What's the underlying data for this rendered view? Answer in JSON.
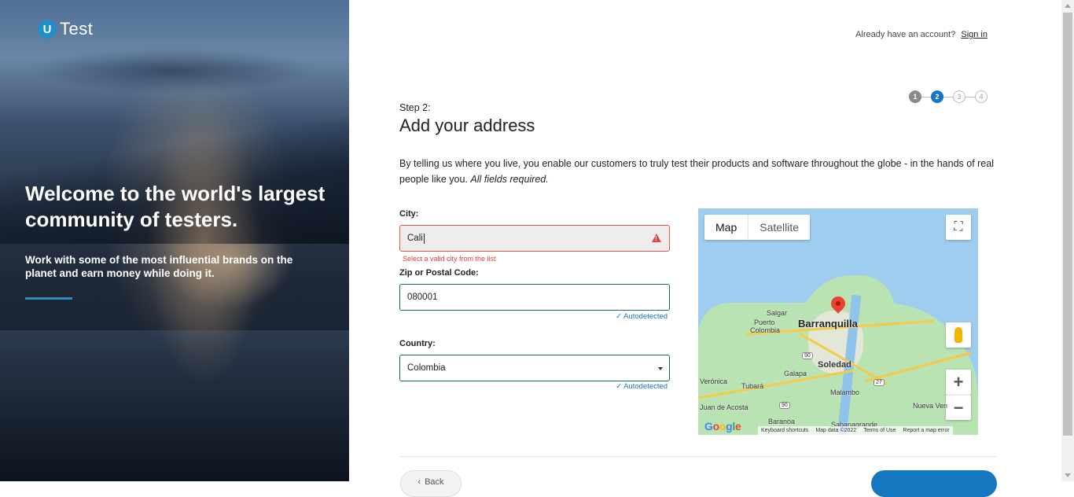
{
  "brand": {
    "badge": "U",
    "name": "Test",
    "accent": "#1477c0"
  },
  "hero": {
    "title": "Welcome to the world's largest community of testers.",
    "subtitle": "Work with some of the most influential brands on the planet and earn money while doing it."
  },
  "account": {
    "prompt": "Already have an account?",
    "sign_in": "Sign in"
  },
  "stepper": {
    "steps": [
      "1",
      "2",
      "3",
      "4"
    ],
    "current": 2
  },
  "form": {
    "step_label": "Step 2:",
    "title": "Add your address",
    "intro": "By telling us where you live, you enable our customers to truly test their products and software throughout the globe - in the hands of real people like you.",
    "intro_required": "All fields required.",
    "city": {
      "label": "City:",
      "value": "Cali",
      "error": "Select a valid city from the list",
      "error_color": "#e04040"
    },
    "zip": {
      "label": "Zip or Postal Code:",
      "value": "080001",
      "status": "Autodetected"
    },
    "country": {
      "label": "Country:",
      "value": "Colombia",
      "status": "Autodetected"
    }
  },
  "map": {
    "tabs": [
      "Map",
      "Satellite"
    ],
    "active_tab": "Map",
    "labels": {
      "city_main": "Barranquilla",
      "soledad": "Soledad",
      "salgar": "Salgar",
      "puerto": "Puerto",
      "colombia": "Colombia",
      "galapa": "Galapa",
      "malambo": "Malambo",
      "tubara": "Tubará",
      "veronica": "Verónica",
      "juan": "Juan de Acosta",
      "baranoa": "Baranoa",
      "sabana": "Sabanagrande",
      "nueva": "Nueva Ven"
    },
    "shields": {
      "r90a": "90",
      "r90b": "90",
      "r27": "27"
    },
    "logo": "Google",
    "attribution": [
      "Keyboard shortcuts",
      "Map data ©2022",
      "Terms of Use",
      "Report a map error"
    ]
  },
  "footer": {
    "back": "Back"
  }
}
